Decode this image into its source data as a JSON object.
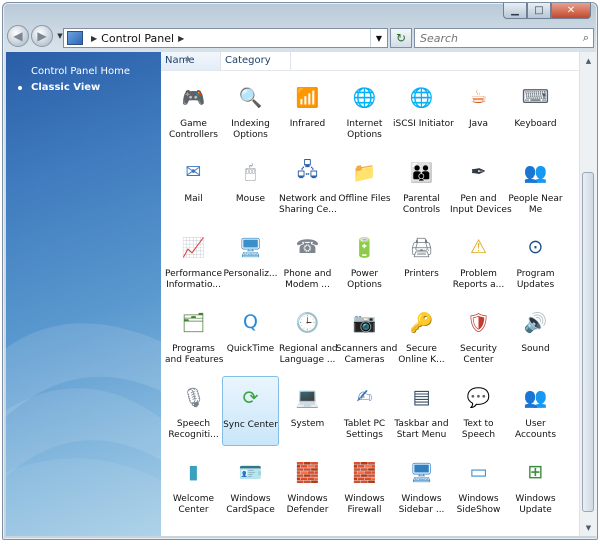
{
  "address": {
    "crumb": "Control Panel"
  },
  "search": {
    "placeholder": "Search"
  },
  "sidebar": {
    "items": [
      {
        "label": "Control Panel Home"
      },
      {
        "label": "Classic View"
      }
    ]
  },
  "columns": {
    "name": "Name",
    "category": "Category"
  },
  "items": [
    {
      "l1": "Game",
      "l2": "Controllers",
      "icon": "gamepad-icon",
      "glyph": "🎮",
      "color": "#3a3f4a"
    },
    {
      "l1": "Indexing",
      "l2": "Options",
      "icon": "indexing-icon",
      "glyph": "🔍",
      "color": "#9aa6b2"
    },
    {
      "l1": "Infrared",
      "l2": "",
      "icon": "infrared-icon",
      "glyph": "📶",
      "color": "#d23b2b"
    },
    {
      "l1": "Internet",
      "l2": "Options",
      "icon": "globe-doc-icon",
      "glyph": "🌐",
      "color": "#2c6fb5"
    },
    {
      "l1": "iSCSI Initiator",
      "l2": "",
      "icon": "globe-icon",
      "glyph": "🌐",
      "color": "#2c8f3e"
    },
    {
      "l1": "Java",
      "l2": "",
      "icon": "java-icon",
      "glyph": "☕",
      "color": "#d85c1f"
    },
    {
      "l1": "Keyboard",
      "l2": "",
      "icon": "keyboard-icon",
      "glyph": "⌨",
      "color": "#55606c"
    },
    {
      "l1": "Mail",
      "l2": "",
      "icon": "mail-icon",
      "glyph": "✉",
      "color": "#3b77c5"
    },
    {
      "l1": "Mouse",
      "l2": "",
      "icon": "mouse-icon",
      "glyph": "🖱",
      "color": "#8a939d"
    },
    {
      "l1": "Network and",
      "l2": "Sharing Ce...",
      "icon": "network-icon",
      "glyph": "🖧",
      "color": "#2e5fa8"
    },
    {
      "l1": "Offline Files",
      "l2": "",
      "icon": "folder-icon",
      "glyph": "📁",
      "color": "#e3b53a"
    },
    {
      "l1": "Parental",
      "l2": "Controls",
      "icon": "family-icon",
      "glyph": "👪",
      "color": "#5b8f3e"
    },
    {
      "l1": "Pen and",
      "l2": "Input Devices",
      "icon": "pen-icon",
      "glyph": "✒",
      "color": "#333a44"
    },
    {
      "l1": "People Near",
      "l2": "Me",
      "icon": "people-icon",
      "glyph": "👥",
      "color": "#4d9a3c"
    },
    {
      "l1": "Performance",
      "l2": "Informatio...",
      "icon": "performance-icon",
      "glyph": "📈",
      "color": "#2c8a3a"
    },
    {
      "l1": "Personaliz...",
      "l2": "",
      "icon": "monitor-icon",
      "glyph": "🖥",
      "color": "#3a8fc8"
    },
    {
      "l1": "Phone and",
      "l2": "Modem ...",
      "icon": "phone-icon",
      "glyph": "☎",
      "color": "#7d858e"
    },
    {
      "l1": "Power",
      "l2": "Options",
      "icon": "power-icon",
      "glyph": "🔋",
      "color": "#3ea03a"
    },
    {
      "l1": "Printers",
      "l2": "",
      "icon": "printer-icon",
      "glyph": "🖨",
      "color": "#6f7983"
    },
    {
      "l1": "Problem",
      "l2": "Reports a...",
      "icon": "warning-icon",
      "glyph": "⚠",
      "color": "#e0a81f"
    },
    {
      "l1": "Program",
      "l2": "Updates",
      "icon": "program-updates-icon",
      "glyph": "⊙",
      "color": "#1f4f8a"
    },
    {
      "l1": "Programs",
      "l2": "and Features",
      "icon": "programs-icon",
      "glyph": "🗂",
      "color": "#4b7d3a"
    },
    {
      "l1": "QuickTime",
      "l2": "",
      "icon": "quicktime-icon",
      "glyph": "Q",
      "color": "#2a8ad6"
    },
    {
      "l1": "Regional and",
      "l2": "Language ...",
      "icon": "clock-globe-icon",
      "glyph": "🕒",
      "color": "#3270b7"
    },
    {
      "l1": "Scanners and",
      "l2": "Cameras",
      "icon": "scanner-icon",
      "glyph": "📷",
      "color": "#6c747d"
    },
    {
      "l1": "Secure",
      "l2": "Online K...",
      "icon": "secure-key-icon",
      "glyph": "🔑",
      "color": "#3a9fbf"
    },
    {
      "l1": "Security",
      "l2": "Center",
      "icon": "shield-icon",
      "glyph": "🛡",
      "color": "#c43c2f"
    },
    {
      "l1": "Sound",
      "l2": "",
      "icon": "speaker-icon",
      "glyph": "🔊",
      "color": "#8c949c"
    },
    {
      "l1": "Speech",
      "l2": "Recogniti...",
      "icon": "microphone-icon",
      "glyph": "🎙",
      "color": "#7a828b"
    },
    {
      "l1": "Sync Center",
      "l2": "",
      "icon": "sync-icon",
      "glyph": "⟳",
      "color": "#3aa33a"
    },
    {
      "l1": "System",
      "l2": "",
      "icon": "system-icon",
      "glyph": "💻",
      "color": "#4a7fb8"
    },
    {
      "l1": "Tablet PC",
      "l2": "Settings",
      "icon": "tablet-icon",
      "glyph": "✍",
      "color": "#3d6fb0"
    },
    {
      "l1": "Taskbar and",
      "l2": "Start Menu",
      "icon": "taskbar-icon",
      "glyph": "▤",
      "color": "#3b4f66"
    },
    {
      "l1": "Text to",
      "l2": "Speech",
      "icon": "text-speech-icon",
      "glyph": "💬",
      "color": "#d9a63a"
    },
    {
      "l1": "User",
      "l2": "Accounts",
      "icon": "users-icon",
      "glyph": "👥",
      "color": "#3f8fc0"
    },
    {
      "l1": "Welcome",
      "l2": "Center",
      "icon": "welcome-icon",
      "glyph": "▮",
      "color": "#3aa0bd"
    },
    {
      "l1": "Windows",
      "l2": "CardSpace",
      "icon": "cardspace-icon",
      "glyph": "🪪",
      "color": "#5a7fc2"
    },
    {
      "l1": "Windows",
      "l2": "Defender",
      "icon": "defender-icon",
      "glyph": "🧱",
      "color": "#8c8f93"
    },
    {
      "l1": "Windows",
      "l2": "Firewall",
      "icon": "firewall-icon",
      "glyph": "🧱",
      "color": "#b8432f"
    },
    {
      "l1": "Windows",
      "l2": "Sidebar ...",
      "icon": "sidebar-icon",
      "glyph": "🖥",
      "color": "#2f7fc1"
    },
    {
      "l1": "Windows",
      "l2": "SideShow",
      "icon": "sideshow-icon",
      "glyph": "▭",
      "color": "#3a8fd0"
    },
    {
      "l1": "Windows",
      "l2": "Update",
      "icon": "update-icon",
      "glyph": "⊞",
      "color": "#3b8c3e"
    }
  ],
  "selected_index": 29
}
